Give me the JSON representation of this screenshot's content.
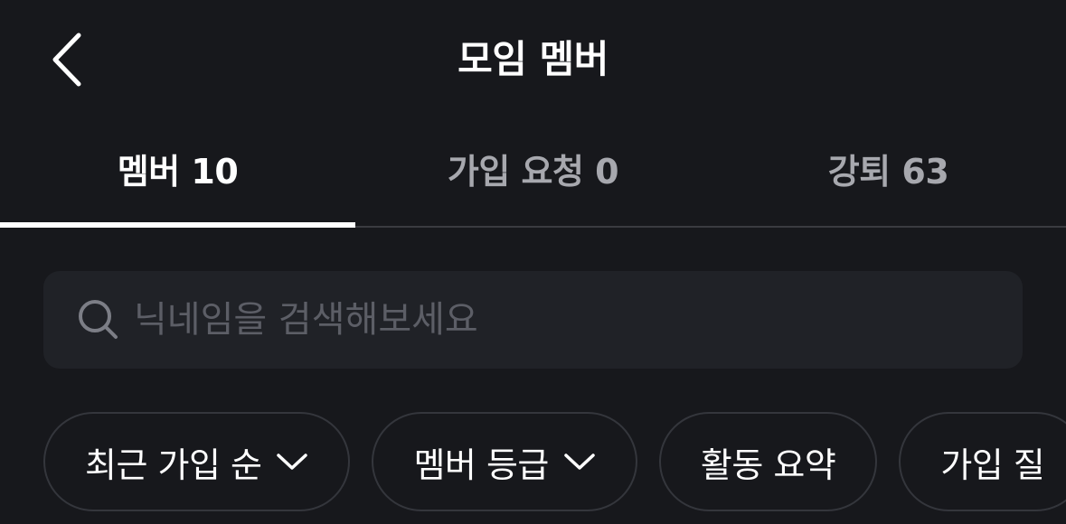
{
  "header": {
    "title": "모임 멤버",
    "back_icon": "chevron-left-icon"
  },
  "tabs": [
    {
      "label": "멤버 10",
      "active": true
    },
    {
      "label": "가입 요청 0",
      "active": false
    },
    {
      "label": "강퇴 63",
      "active": false
    }
  ],
  "search": {
    "placeholder": "닉네임을 검색해보세요",
    "value": "",
    "icon": "search-icon"
  },
  "filters": [
    {
      "label": "최근 가입 순",
      "has_dropdown": true
    },
    {
      "label": "멤버 등급",
      "has_dropdown": true
    },
    {
      "label": "활동 요약",
      "has_dropdown": false
    },
    {
      "label": "가입 질",
      "has_dropdown": false
    }
  ],
  "colors": {
    "background": "#17181c",
    "search_bg": "#202227",
    "text_primary": "#ffffff",
    "text_inactive": "#a7a8ae",
    "placeholder": "#5c5e66",
    "chip_border": "#34363c"
  }
}
